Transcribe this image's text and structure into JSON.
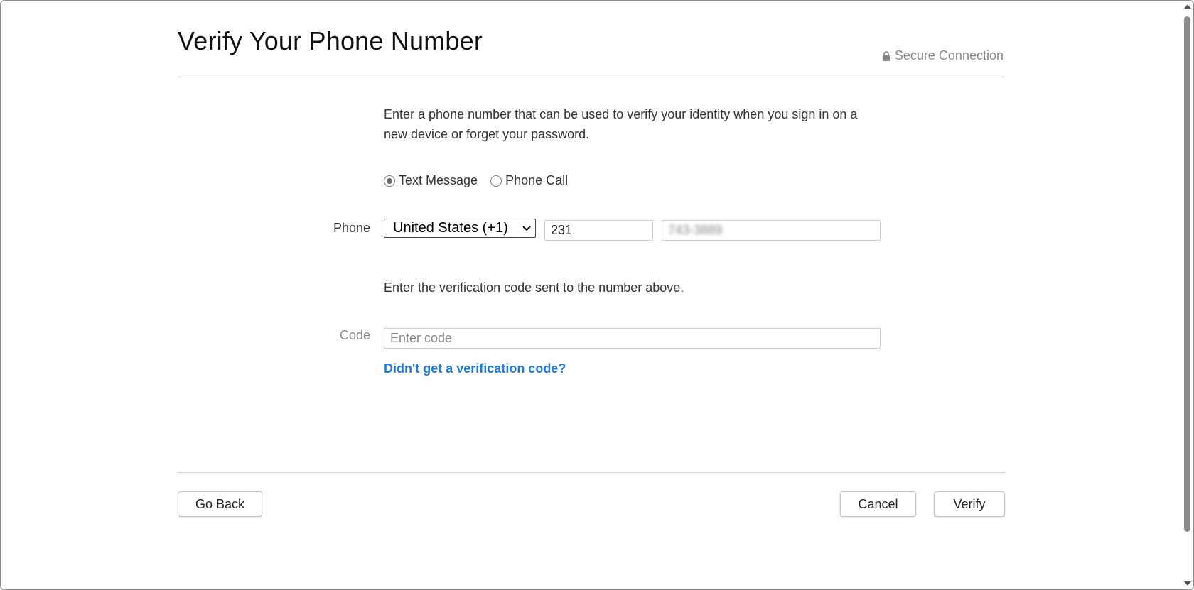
{
  "page": {
    "title": "Verify Your Phone Number",
    "secure_label": "Secure Connection"
  },
  "form": {
    "description": "Enter a phone number that can be used to verify your identity when you sign in on a new device or forget your password.",
    "methods": [
      {
        "label": "Text Message",
        "selected": true
      },
      {
        "label": "Phone Call",
        "selected": false
      }
    ],
    "phone_label": "Phone",
    "country_selected": "United States (+1)",
    "area_code_value": "231",
    "number_value": "743-3889",
    "verify_instruction": "Enter the verification code sent to the number above.",
    "code_label": "Code",
    "code_placeholder": "Enter code",
    "help_link": "Didn't get a verification code?"
  },
  "footer": {
    "back_label": "Go Back",
    "cancel_label": "Cancel",
    "verify_label": "Verify"
  },
  "colors": {
    "link": "#1f7ad8",
    "muted": "#888888",
    "divider": "#d6d6d6"
  },
  "icons": [
    "lock-icon",
    "chevron-down-icon"
  ]
}
